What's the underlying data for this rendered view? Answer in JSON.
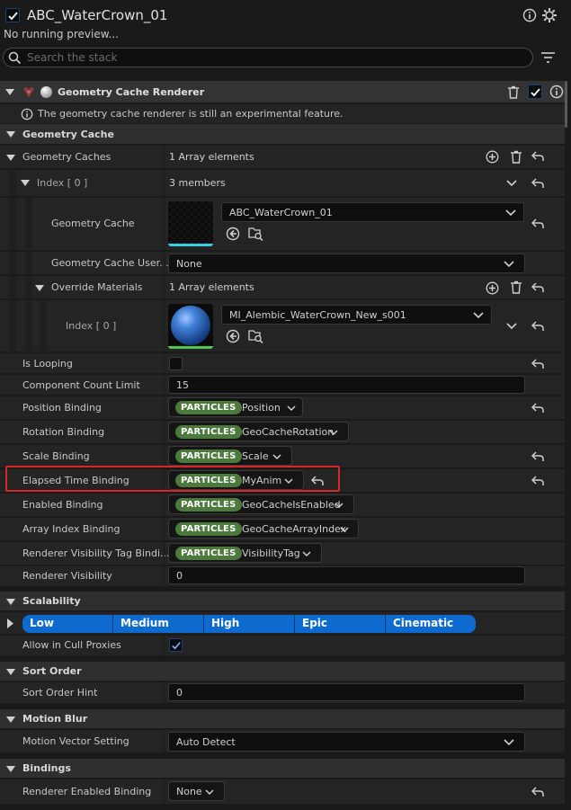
{
  "header": {
    "title": "ABC_WaterCrown_01",
    "preview_status": "No running preview...",
    "search_placeholder": "Search the stack"
  },
  "module": {
    "title": "Geometry Cache Renderer",
    "warning": "The geometry cache renderer is still an experimental feature."
  },
  "sections": {
    "geometry_cache": "Geometry Cache",
    "scalability": "Scalability",
    "sort_order": "Sort Order",
    "motion_blur": "Motion Blur",
    "bindings": "Bindings"
  },
  "geometry_cache": {
    "caches_label": "Geometry Caches",
    "caches_value": "1 Array elements",
    "index_label": "Index [ 0 ]",
    "index_value": "3 members",
    "cache_label": "Geometry Cache",
    "cache_asset": "ABC_WaterCrown_01",
    "user_label": "Geometry Cache User...",
    "user_value": "None",
    "override_label": "Override Materials",
    "override_value": "1 Array elements",
    "override_index_label": "Index [ 0 ]",
    "material_asset": "MI_Alembic_WaterCrown_New_s001"
  },
  "properties": {
    "is_looping": "Is Looping",
    "component_count_label": "Component Count Limit",
    "component_count_value": "15",
    "position_binding": "Position Binding",
    "position_value": "Position",
    "rotation_binding": "Rotation Binding",
    "rotation_value": "GeoCacheRotation",
    "scale_binding": "Scale Binding",
    "scale_value": "Scale",
    "elapsed_binding": "Elapsed Time Binding",
    "elapsed_value": "MyAnim",
    "enabled_binding": "Enabled Binding",
    "enabled_value": "GeoCacheIsEnabled",
    "array_index_binding": "Array Index Binding",
    "array_index_value": "GeoCacheArrayIndex",
    "visibility_tag_binding": "Renderer Visibility Tag Bindi...",
    "visibility_tag_value": "VisibilityTag",
    "renderer_visibility_label": "Renderer Visibility",
    "renderer_visibility_value": "0",
    "particles_tag": "PARTICLES"
  },
  "scalability": {
    "tiers": [
      "Low",
      "Medium",
      "High",
      "Epic",
      "Cinematic"
    ],
    "cull_label": "Allow in Cull Proxies"
  },
  "sort": {
    "hint_label": "Sort Order Hint",
    "hint_value": "0"
  },
  "motion": {
    "vector_label": "Motion Vector Setting",
    "vector_value": "Auto Detect"
  },
  "bindings": {
    "renderer_enabled_label": "Renderer Enabled Binding",
    "renderer_enabled_value": "None"
  },
  "colors": {
    "highlight": "#d9262c",
    "accent": "#0f6ad0",
    "particles_tag": "#4b7a3c"
  }
}
